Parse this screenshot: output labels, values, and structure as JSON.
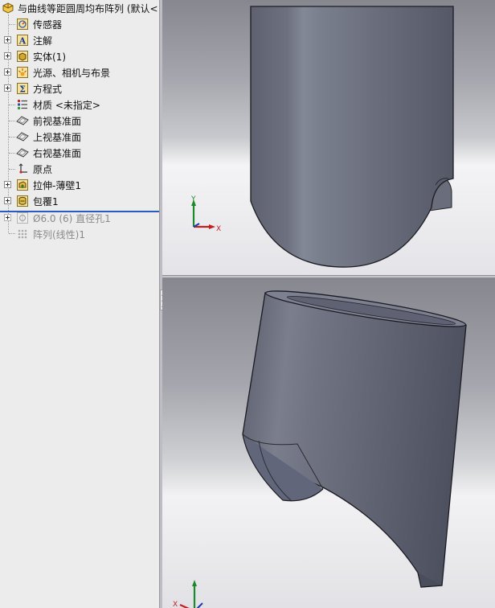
{
  "tree": {
    "root_label": "与曲线等距圆周均布阵列  (默认<",
    "items": [
      {
        "label": "传感器"
      },
      {
        "label": "注解"
      },
      {
        "label": "实体(1)"
      },
      {
        "label": "光源、相机与布景"
      },
      {
        "label": "方程式"
      },
      {
        "label": "材质 <未指定>"
      },
      {
        "label": "前视基准面"
      },
      {
        "label": "上视基准面"
      },
      {
        "label": "右视基准面"
      },
      {
        "label": "原点"
      },
      {
        "label": "拉伸-薄壁1"
      },
      {
        "label": "包覆1"
      },
      {
        "label": "Ø6.0 (6) 直径孔1"
      },
      {
        "label": "阵列(线性)1"
      }
    ]
  },
  "triad": {
    "y_label": "Y",
    "x_label": "X"
  }
}
